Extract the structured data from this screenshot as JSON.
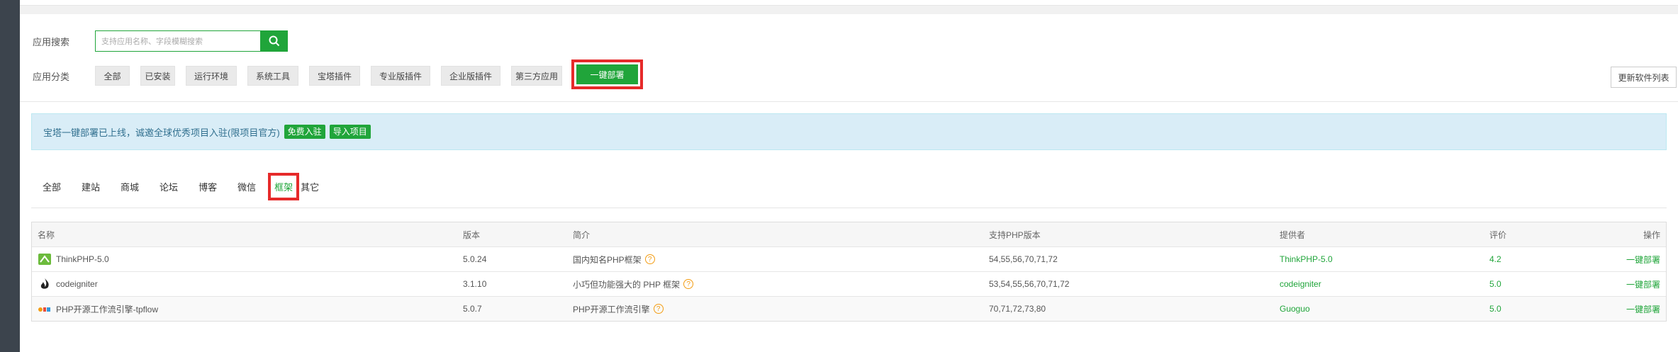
{
  "filters": {
    "search_label": "应用搜索",
    "search_placeholder": "支持应用名称、字段模糊搜索",
    "category_label": "应用分类",
    "categories": [
      "全部",
      "已安装",
      "运行环境",
      "系统工具",
      "宝塔插件",
      "专业版插件",
      "企业版插件",
      "第三方应用"
    ],
    "active_category": "一键部署",
    "update_button": "更新软件列表"
  },
  "notice": {
    "text": "宝塔一键部署已上线，诚邀全球优秀项目入驻(限项目官方)",
    "tag1": "免费入驻",
    "tag2": "导入项目"
  },
  "tabs": {
    "items": [
      "全部",
      "建站",
      "商城",
      "论坛",
      "博客",
      "微信"
    ],
    "active": "框架",
    "last": "其它"
  },
  "table": {
    "headers": [
      "名称",
      "版本",
      "简介",
      "支持PHP版本",
      "提供者",
      "评价",
      "操作"
    ],
    "rows": [
      {
        "name": "ThinkPHP-5.0",
        "version": "5.0.24",
        "desc": "国内知名PHP框架",
        "php": "54,55,56,70,71,72",
        "provider": "ThinkPHP-5.0",
        "rating": "4.2",
        "action": "一键部署"
      },
      {
        "name": "codeigniter",
        "version": "3.1.10",
        "desc": "小巧但功能强大的 PHP 框架",
        "php": "53,54,55,56,70,71,72",
        "provider": "codeigniter",
        "rating": "5.0",
        "action": "一键部署"
      },
      {
        "name": "PHP开源工作流引擎-tpflow",
        "version": "5.0.7",
        "desc": "PHP开源工作流引擎",
        "php": "70,71,72,73,80",
        "provider": "Guoguo",
        "rating": "5.0",
        "action": "一键部署"
      }
    ]
  },
  "colors": {
    "accent": "#20a53a",
    "highlight": "#e62a2a",
    "notice_bg": "#d9edf7"
  },
  "icons": {
    "search": "search-icon",
    "question": "question-icon"
  }
}
